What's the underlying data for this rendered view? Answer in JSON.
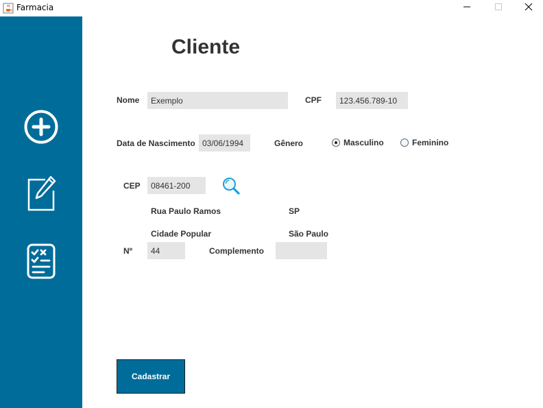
{
  "window": {
    "title": "Farmacia",
    "icon": "java-coffee-icon"
  },
  "colors": {
    "sidebar": "#006c9a",
    "button": "#006c9a",
    "field_bg": "#e5e5e5",
    "text": "#333333"
  },
  "sidebar": {
    "items": [
      {
        "icon": "add-circle-icon"
      },
      {
        "icon": "edit-document-icon"
      },
      {
        "icon": "checklist-icon"
      }
    ]
  },
  "form": {
    "title": "Cliente",
    "nome": {
      "label": "Nome",
      "value": "Exemplo"
    },
    "cpf": {
      "label": "CPF",
      "value": "123.456.789-10"
    },
    "nascimento": {
      "label": "Data de Nascimento",
      "value": "03/06/1994"
    },
    "genero": {
      "label": "Gênero",
      "options": [
        {
          "label": "Masculino",
          "selected": true
        },
        {
          "label": "Feminino",
          "selected": false
        }
      ]
    },
    "cep": {
      "label": "CEP",
      "value": "08461-200",
      "search_icon": "search-icon"
    },
    "endereco": {
      "rua": "Rua Paulo Ramos",
      "uf": "SP",
      "bairro": "Cidade Popular",
      "cidade": "São Paulo"
    },
    "numero": {
      "label": "Nº",
      "value": "44"
    },
    "complemento": {
      "label": "Complemento",
      "value": ""
    },
    "submit_label": "Cadastrar"
  }
}
